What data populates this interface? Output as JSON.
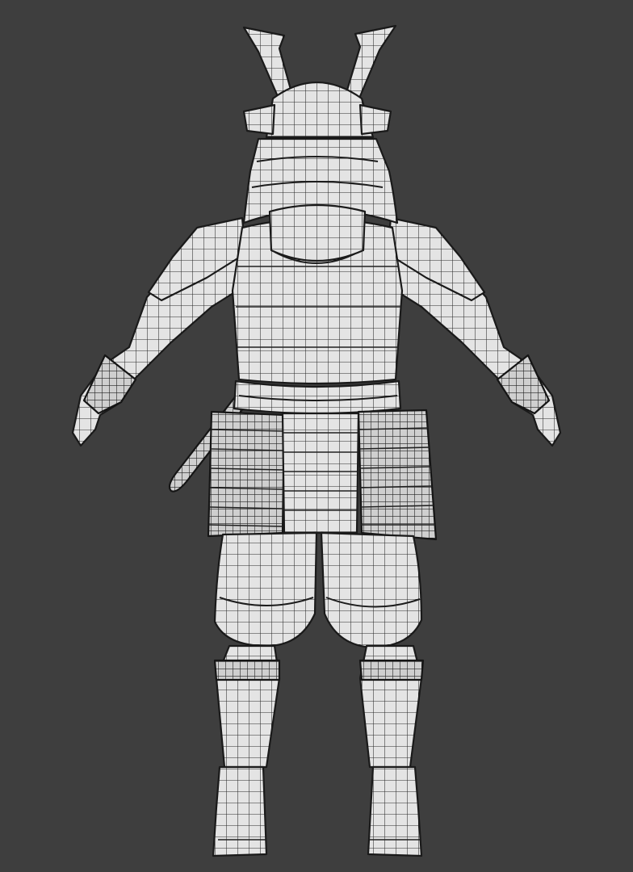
{
  "viewport": {
    "background": "#3e3e3e",
    "model": {
      "subject": "samurai-armor",
      "view": "back",
      "display": "wireframe-on-shaded",
      "surface_color": "#e6e6e6",
      "wire_color": "#1e1e1e"
    }
  }
}
